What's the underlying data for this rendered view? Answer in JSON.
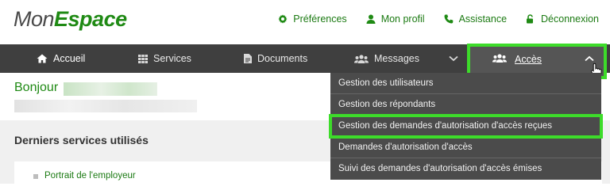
{
  "header": {
    "logo_light": "Mon",
    "logo_bold": "Espace",
    "links": [
      {
        "label": "Préférences",
        "icon": "gear-icon"
      },
      {
        "label": "Mon profil",
        "icon": "user-icon"
      },
      {
        "label": "Assistance",
        "icon": "phone-icon"
      },
      {
        "label": "Déconnexion",
        "icon": "unlock-icon"
      }
    ]
  },
  "nav": {
    "items": [
      {
        "label": "Accueil",
        "icon": "home-icon"
      },
      {
        "label": "Services",
        "icon": "grid-icon"
      },
      {
        "label": "Documents",
        "icon": "document-icon"
      },
      {
        "label": "Messages",
        "icon": "users-icon"
      }
    ],
    "acces": {
      "label": "Accès",
      "icon": "users-icon"
    }
  },
  "dropdown": {
    "items": [
      "Gestion des utilisateurs",
      "Gestion des répondants",
      "Gestion des demandes d'autorisation d'accès reçues",
      "Demandes d'autorisation d'accès",
      "Suivi des demandes d'autorisation d'accès émises"
    ],
    "highlighted_index": 2
  },
  "main": {
    "greeting": "Bonjour",
    "section_title": "Derniers services utilisés",
    "recent_links": [
      "Portrait de l'employeur"
    ]
  },
  "colors": {
    "brand_green": "#1f8a14",
    "highlight_green": "#3ddc2a",
    "nav_bg": "#3f3f3f",
    "dropdown_bg": "#4b4b4b"
  }
}
